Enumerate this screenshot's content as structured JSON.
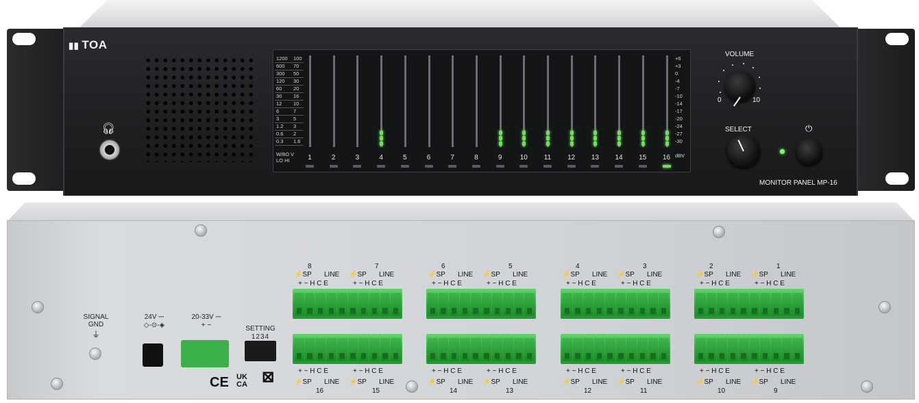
{
  "front": {
    "brand": "TOA",
    "headphone_icon": "headphone-icon",
    "meter": {
      "left_scale_w": [
        "1200",
        "600",
        "300",
        "120",
        "60",
        "30",
        "12",
        "6",
        "3",
        "1.2",
        "0.6",
        "0.3"
      ],
      "left_scale_v": [
        "100",
        "70",
        "50",
        "30",
        "20",
        "16",
        "10",
        "7",
        "5",
        "3",
        "2",
        "1.6"
      ],
      "left_footer_1": "W/8Ω  V",
      "left_footer_2": "LO    HI",
      "right_scale": [
        "+6",
        "+3",
        "0",
        "-4",
        "-7",
        "-10",
        "-14",
        "-17",
        "-20",
        "-24",
        "-27",
        "-30"
      ],
      "right_unit": "dBV",
      "channels": [
        "1",
        "2",
        "3",
        "4",
        "5",
        "6",
        "7",
        "8",
        "9",
        "10",
        "11",
        "12",
        "13",
        "14",
        "15",
        "16"
      ],
      "active_channels": [
        4,
        9,
        10,
        11,
        12,
        13,
        14,
        15,
        16
      ],
      "selected_channel": 16,
      "accent_color": "#6fe05a"
    },
    "volume_label": "VOLUME",
    "volume_min": "0",
    "volume_max": "10",
    "select_label": "SELECT",
    "power_icon": "power-icon",
    "model_label": "MONITOR PANEL  MP-16"
  },
  "rear": {
    "signal_gnd": "SIGNAL\nGND",
    "dc_24v": "24V ⎓",
    "dc_20_33v": "20-33V ⎓",
    "dc_polarity": "+ −",
    "setting": "SETTING",
    "setting_bits": "1234",
    "ce": "CE",
    "ukca": "UK\nCA",
    "weee": "⊠",
    "top_groups": [
      {
        "a": "8",
        "b": "7"
      },
      {
        "a": "6",
        "b": "5"
      },
      {
        "a": "4",
        "b": "3"
      },
      {
        "a": "2",
        "b": "1"
      }
    ],
    "bottom_groups": [
      {
        "a": "16",
        "b": "15"
      },
      {
        "a": "14",
        "b": "13"
      },
      {
        "a": "12",
        "b": "11"
      },
      {
        "a": "10",
        "b": "9"
      }
    ],
    "sp_label": "SP",
    "line_label": "LINE",
    "pins": "+ −  H C E"
  }
}
